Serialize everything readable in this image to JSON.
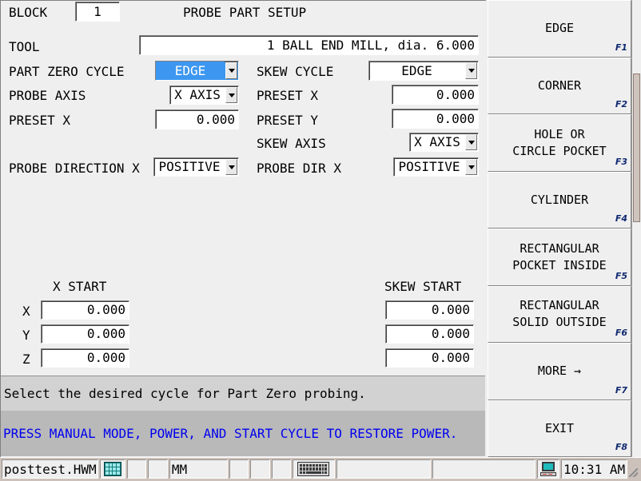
{
  "header": {
    "block_label": "BLOCK",
    "block_value": "1",
    "title": "PROBE PART SETUP"
  },
  "tool": {
    "label": "TOOL",
    "value": "1 BALL END MILL, dia. 6.000"
  },
  "left_form": {
    "part_zero_cycle_label": "PART ZERO CYCLE",
    "part_zero_cycle_value": "EDGE",
    "probe_axis_label": "PROBE AXIS",
    "probe_axis_value": "X AXIS",
    "preset_x_label": "PRESET X",
    "preset_x_value": "0.000",
    "probe_direction_label": "PROBE DIRECTION X",
    "probe_direction_value": "POSITIVE"
  },
  "right_form": {
    "skew_cycle_label": "SKEW CYCLE",
    "skew_cycle_value": "EDGE",
    "preset_x_label": "PRESET X",
    "preset_x_value": "0.000",
    "preset_y_label": "PRESET Y",
    "preset_y_value": "0.000",
    "skew_axis_label": "SKEW AXIS",
    "skew_axis_value": "X AXIS",
    "probe_dir_label": "PROBE DIR X",
    "probe_dir_value": "POSITIVE"
  },
  "start_table": {
    "left_header": "X START",
    "right_header": "SKEW START",
    "rows": [
      {
        "axis": "X",
        "left_value": "0.000",
        "right_value": "0.000"
      },
      {
        "axis": "Y",
        "left_value": "0.000",
        "right_value": "0.000"
      },
      {
        "axis": "Z",
        "left_value": "0.000",
        "right_value": "0.000"
      }
    ]
  },
  "messages": {
    "info": "Select the desired cycle for Part Zero probing.",
    "alert": "PRESS MANUAL MODE, POWER, AND START CYCLE TO RESTORE POWER.",
    "alert_color": "#0000ee"
  },
  "function_keys": [
    {
      "label": "EDGE",
      "key": "F1"
    },
    {
      "label": "CORNER",
      "key": "F2"
    },
    {
      "label": "HOLE OR\nCIRCLE POCKET",
      "key": "F3"
    },
    {
      "label": "CYLINDER",
      "key": "F4"
    },
    {
      "label": "RECTANGULAR\nPOCKET INSIDE",
      "key": "F5"
    },
    {
      "label": "RECTANGULAR\nSOLID OUTSIDE",
      "key": "F6"
    },
    {
      "label": "MORE →",
      "key": "F7"
    },
    {
      "label": "EXIT",
      "key": "F8"
    }
  ],
  "statusbar": {
    "filename": "posttest.HWM",
    "keypad_icon": "keypad-icon",
    "units": "MM",
    "keyboard_icon": "keyboard-icon",
    "pc_icon": "pc-icon",
    "time": "10:31 AM"
  },
  "colors": {
    "selection_blue": "#3d97f0",
    "fkey_label": "#102a70",
    "panel_bg": "#efefef",
    "info_bg": "#d2d2d2",
    "alert_bg": "#b9b9b9"
  }
}
